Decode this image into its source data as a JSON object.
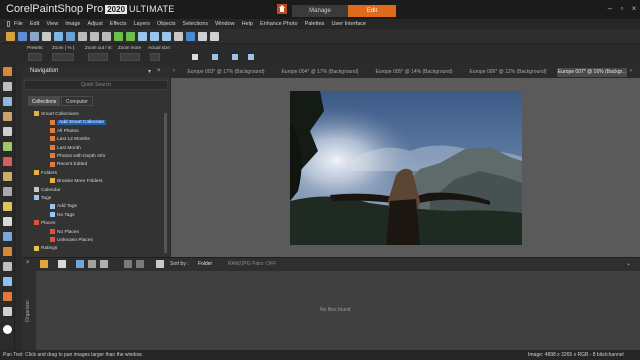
{
  "app": {
    "logo_corel": "Corel",
    "logo_psp": "PaintShop Pro",
    "logo_year": "2020",
    "logo_edition": "ULTIMATE"
  },
  "modes": {
    "manage": "Manage",
    "edit": "Edit"
  },
  "menu": [
    "File",
    "Edit",
    "View",
    "Image",
    "Adjust",
    "Effects",
    "Layers",
    "Objects",
    "Selections",
    "Window",
    "Help",
    "Enhance Photo",
    "Palettes",
    "User Interface"
  ],
  "tool_options": {
    "presets": "Presets:",
    "zoom": "Zoom ( % ):",
    "zoom_out_in": "Zoom out / in:",
    "zoom_more": "Zoom more",
    "actual_size": "Actual size:"
  },
  "navigation": {
    "title": "Navigation",
    "search_placeholder": "Quick Search",
    "tabs": [
      "Collections",
      "Computer"
    ],
    "tree": [
      {
        "label": "Smart Collections",
        "level": 1,
        "icon": "folder-icon"
      },
      {
        "label": "Add Smart Collection",
        "level": 2,
        "icon": "smart-collection-icon",
        "selected": true
      },
      {
        "label": "All Photos",
        "level": 2,
        "icon": "smart-collection-icon"
      },
      {
        "label": "Last 12 Months",
        "level": 2,
        "icon": "smart-collection-icon"
      },
      {
        "label": "Last Month",
        "level": 2,
        "icon": "smart-collection-icon"
      },
      {
        "label": "Photos with Depth Info",
        "level": 2,
        "icon": "smart-collection-icon"
      },
      {
        "label": "Recent Edited",
        "level": 2,
        "icon": "smart-collection-icon"
      },
      {
        "label": "Folders",
        "level": 1,
        "icon": "folder-icon"
      },
      {
        "label": "Browse More Folders",
        "level": 2,
        "icon": "folder-icon"
      },
      {
        "label": "Calendar",
        "level": 1,
        "icon": "calendar-icon"
      },
      {
        "label": "Tags",
        "level": 1,
        "icon": "tag-icon"
      },
      {
        "label": "Add Tags",
        "level": 2,
        "icon": "tag-icon"
      },
      {
        "label": "No Tags",
        "level": 2,
        "icon": "tag-icon"
      },
      {
        "label": "Places",
        "level": 1,
        "icon": "pin-icon"
      },
      {
        "label": "No Places",
        "level": 2,
        "icon": "pin-icon"
      },
      {
        "label": "Unknown Places",
        "level": 2,
        "icon": "pin-icon"
      },
      {
        "label": "Ratings",
        "level": 1,
        "icon": "star-icon"
      }
    ]
  },
  "doc_tabs": [
    "Europe 003* @ 17% (Background)",
    "Europe 004* @ 17% (Background)",
    "Europe 005* @ 14% (Background)",
    "Europe 006* @ 12% (Background)",
    "Europe 007* @ 16% (Backgr..."
  ],
  "organizer": {
    "sort_label": "Sort by :",
    "sort_value": "Folder",
    "filter": "RAW/JPG Pairs: OFF",
    "side_label": "Organizer",
    "empty_text": "No files found"
  },
  "status": {
    "left": "Pan Tool: Click and drag to pan images larger than the window.",
    "right": "Image: 4898 x 3265 x RGB - 8 bits/channel"
  },
  "colors": {
    "accent": "#e06a1c",
    "selection": "#1e5fae"
  }
}
